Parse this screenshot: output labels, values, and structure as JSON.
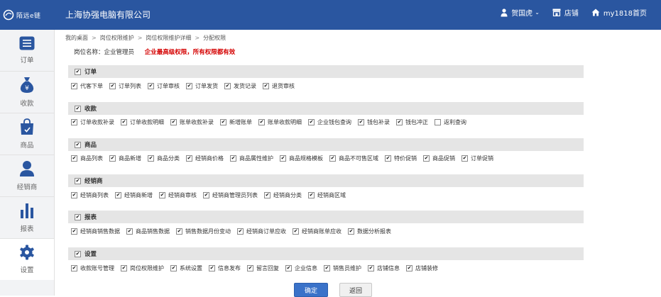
{
  "header": {
    "logo_text": "陌远e链",
    "company": "上海协强电脑有限公司",
    "user": "贺国虎",
    "shop": "店铺",
    "home": "my1818首页"
  },
  "sidebar": [
    {
      "label": "订单",
      "icon": "list-icon"
    },
    {
      "label": "收款",
      "icon": "money-bag-icon"
    },
    {
      "label": "商品",
      "icon": "shopping-bag-icon"
    },
    {
      "label": "经销商",
      "icon": "person-icon"
    },
    {
      "label": "报表",
      "icon": "bar-chart-icon"
    },
    {
      "label": "设置",
      "icon": "gear-icon"
    }
  ],
  "breadcrumb": [
    "我的桌面",
    "岗位权限维护",
    "岗位权限维护详细",
    "分配权限"
  ],
  "role": {
    "label": "岗位名称：企业管理员",
    "warning": "企业最高级权限，所有权限都有效"
  },
  "sections": [
    {
      "title": "订单",
      "checked": true,
      "items": [
        {
          "label": "代客下单",
          "checked": true
        },
        {
          "label": "订单列表",
          "checked": true
        },
        {
          "label": "订单审核",
          "checked": true
        },
        {
          "label": "订单发货",
          "checked": true
        },
        {
          "label": "发货记录",
          "checked": true
        },
        {
          "label": "退货审核",
          "checked": true
        }
      ]
    },
    {
      "title": "收款",
      "checked": true,
      "items": [
        {
          "label": "订单收款补录",
          "checked": true
        },
        {
          "label": "订单收款明细",
          "checked": true
        },
        {
          "label": "账单收款补录",
          "checked": true
        },
        {
          "label": "新增账单",
          "checked": true
        },
        {
          "label": "账单收款明细",
          "checked": true
        },
        {
          "label": "企业钱包查询",
          "checked": true
        },
        {
          "label": "钱包补录",
          "checked": true
        },
        {
          "label": "钱包冲正",
          "checked": true
        },
        {
          "label": "返利查询",
          "checked": false
        }
      ]
    },
    {
      "title": "商品",
      "checked": true,
      "items": [
        {
          "label": "商品列表",
          "checked": true
        },
        {
          "label": "商品新增",
          "checked": true
        },
        {
          "label": "商品分类",
          "checked": true
        },
        {
          "label": "经销商价格",
          "checked": true
        },
        {
          "label": "商品属性维护",
          "checked": true
        },
        {
          "label": "商品规格模板",
          "checked": true
        },
        {
          "label": "商品不可售区域",
          "checked": true
        },
        {
          "label": "特价促销",
          "checked": true
        },
        {
          "label": "商品促销",
          "checked": true
        },
        {
          "label": "订单促销",
          "checked": true
        }
      ]
    },
    {
      "title": "经销商",
      "checked": true,
      "items": [
        {
          "label": "经销商列表",
          "checked": true
        },
        {
          "label": "经销商新增",
          "checked": true
        },
        {
          "label": "经销商审核",
          "checked": true
        },
        {
          "label": "经销商管理员列表",
          "checked": true
        },
        {
          "label": "经销商分类",
          "checked": true
        },
        {
          "label": "经销商区域",
          "checked": true
        }
      ]
    },
    {
      "title": "报表",
      "checked": true,
      "items": [
        {
          "label": "经销商销售数据",
          "checked": true
        },
        {
          "label": "商品销售数据",
          "checked": true
        },
        {
          "label": "销售数据月份变动",
          "checked": true
        },
        {
          "label": "经销商订单应收",
          "checked": true
        },
        {
          "label": "经销商账单应收",
          "checked": true
        },
        {
          "label": "数据分析报表",
          "checked": true
        }
      ]
    },
    {
      "title": "设置",
      "checked": true,
      "items": [
        {
          "label": "收款账号管理",
          "checked": true
        },
        {
          "label": "岗位权限维护",
          "checked": true
        },
        {
          "label": "系统设置",
          "checked": true
        },
        {
          "label": "信息发布",
          "checked": true
        },
        {
          "label": "留言回复",
          "checked": true
        },
        {
          "label": "企业信息",
          "checked": true
        },
        {
          "label": "销售员维护",
          "checked": true
        },
        {
          "label": "店铺信息",
          "checked": true
        },
        {
          "label": "店铺装修",
          "checked": true
        }
      ]
    }
  ],
  "buttons": {
    "confirm": "确定",
    "back": "返回"
  },
  "colors": {
    "header_bg": "#2a56a0",
    "warning": "#d40000",
    "primary": "#3a72c9"
  }
}
